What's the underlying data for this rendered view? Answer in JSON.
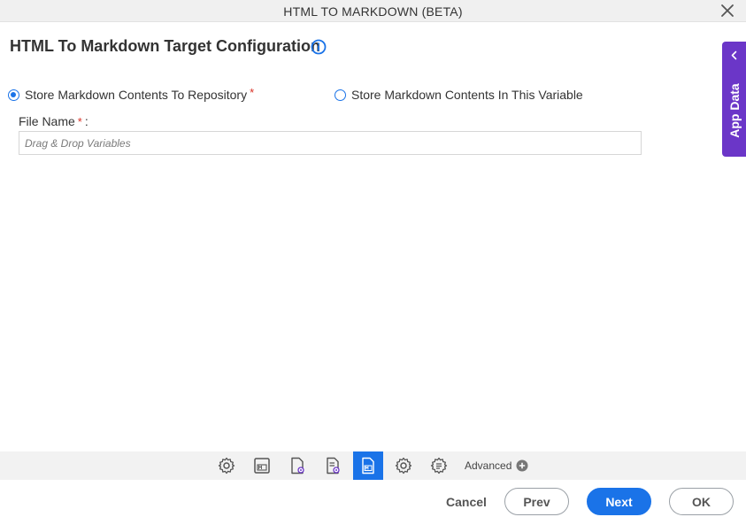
{
  "dialog": {
    "title": "HTML TO MARKDOWN (BETA)"
  },
  "page": {
    "heading": "HTML To Markdown Target Configuration"
  },
  "options": {
    "store_repository": "Store Markdown Contents To Repository",
    "store_repository_required": "*",
    "store_variable": "Store Markdown Contents In This Variable"
  },
  "file_name": {
    "label": "File Name",
    "required": "*",
    "suffix": ":",
    "placeholder": "Drag & Drop Variables",
    "value": ""
  },
  "side_panel": {
    "label": "App Data"
  },
  "toolbar": {
    "advanced_label": "Advanced"
  },
  "footer": {
    "cancel": "Cancel",
    "prev": "Prev",
    "next": "Next",
    "ok": "OK"
  },
  "colors": {
    "accent": "#1a73e8",
    "app_data": "#6b36c8",
    "required": "#d93025",
    "toolbar_bg": "#f2f2f2"
  },
  "icons": [
    "close-icon",
    "info-icon",
    "chevron-left-icon",
    "gear-icon",
    "markdown-file-icon",
    "file-settings-icon",
    "file-list-settings-icon",
    "markdown-doc-icon",
    "gear-icon",
    "list-settings-icon",
    "plus-circle-icon"
  ]
}
